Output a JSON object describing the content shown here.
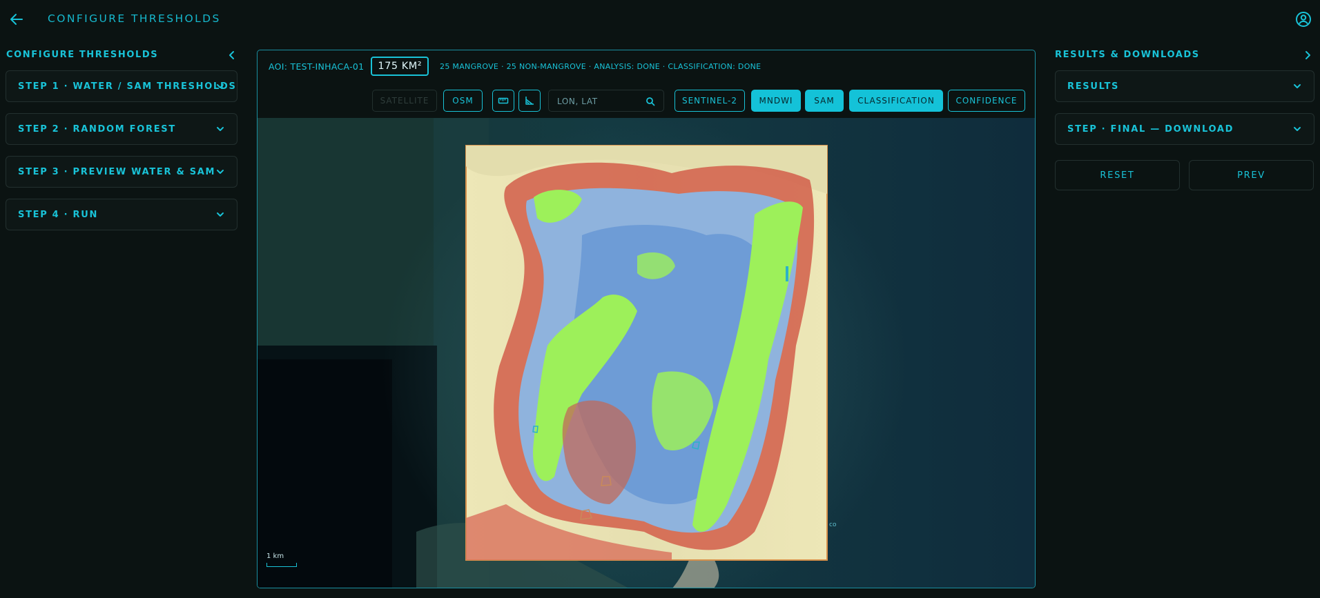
{
  "header": {
    "title": "CONFIGURE THRESHOLDS",
    "back_icon": "arrow-left-icon",
    "user_icon": "user-circle-icon"
  },
  "left_panel": {
    "title": "CONFIGURE THRESHOLDS",
    "steps": [
      {
        "label": "STEP 1 · WATER / SAM THRESHOLDS"
      },
      {
        "label": "STEP 2 · RANDOM FOREST"
      },
      {
        "label": "STEP 3 · PREVIEW WATER & SAM"
      },
      {
        "label": "STEP 4 · RUN"
      }
    ]
  },
  "map_panel": {
    "aoi": "AOI: TEST-INHACA-01",
    "area": "175 KM²",
    "stats": "25 MANGROVE · 25 NON-MANGROVE · ANALYSIS: DONE · CLASSIFICATION: DONE",
    "toolbar": {
      "satellite": "SATELLITE",
      "osm": "OSM",
      "search_placeholder": "LON, LAT",
      "sentinel": "SENTINEL-2",
      "mndwi": "MNDWI",
      "sam": "SAM",
      "classification": "CLASSIFICATION",
      "confidence": "CONFIDENCE"
    },
    "scale_label": "1 km",
    "map_stray_text": "co"
  },
  "right_panel": {
    "title": "RESULTS & DOWNLOADS",
    "cards": [
      {
        "label": "RESULTS"
      },
      {
        "label": "STEP · FINAL — DOWNLOAD"
      }
    ],
    "reset": "RESET",
    "prev": "PREV"
  },
  "colors": {
    "accent": "#19c3d8",
    "background": "#0b1312",
    "vegetation": "#9df05a",
    "water_low": "#d8574a",
    "water_mid": "#ece6b4",
    "water_high": "#6f9fd9"
  }
}
